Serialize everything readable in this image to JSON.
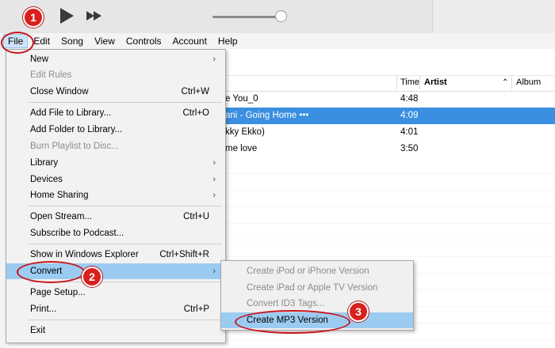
{
  "menubar": {
    "items": [
      {
        "label": "File"
      },
      {
        "label": "Edit"
      },
      {
        "label": "Song"
      },
      {
        "label": "View"
      },
      {
        "label": "Controls"
      },
      {
        "label": "Account"
      },
      {
        "label": "Help"
      }
    ]
  },
  "toolbar": {
    "icons": [
      "play-icon",
      "fast-forward-icon"
    ],
    "volume_level": 0.9
  },
  "table": {
    "headers": {
      "time": "Time",
      "artist": "Artist",
      "album": "Album"
    },
    "rows": [
      {
        "title": "e You_0",
        "time": "4:48",
        "selected": false
      },
      {
        "title": "ani - Going Home •••",
        "time": "4:09",
        "selected": true
      },
      {
        "title": "kky Ekko)",
        "time": "4:01",
        "selected": false
      },
      {
        "title": "me love",
        "time": "3:50",
        "selected": false
      }
    ]
  },
  "file_menu": {
    "items": [
      {
        "label": "New",
        "shortcut": "",
        "submenu": true,
        "disabled": false
      },
      {
        "label": "Edit Rules",
        "shortcut": "",
        "submenu": false,
        "disabled": true
      },
      {
        "label": "Close Window",
        "shortcut": "Ctrl+W",
        "submenu": false,
        "disabled": false
      },
      {
        "label": "Add File to Library...",
        "shortcut": "Ctrl+O",
        "submenu": false,
        "disabled": false
      },
      {
        "label": "Add Folder to Library...",
        "shortcut": "",
        "submenu": false,
        "disabled": false
      },
      {
        "label": "Burn Playlist to Disc...",
        "shortcut": "",
        "submenu": false,
        "disabled": true
      },
      {
        "label": "Library",
        "shortcut": "",
        "submenu": true,
        "disabled": false
      },
      {
        "label": "Devices",
        "shortcut": "",
        "submenu": true,
        "disabled": false
      },
      {
        "label": "Home Sharing",
        "shortcut": "",
        "submenu": true,
        "disabled": false
      },
      {
        "label": "Open Stream...",
        "shortcut": "Ctrl+U",
        "submenu": false,
        "disabled": false
      },
      {
        "label": "Subscribe to Podcast...",
        "shortcut": "",
        "submenu": false,
        "disabled": false
      },
      {
        "label": "Show in Windows Explorer",
        "shortcut": "Ctrl+Shift+R",
        "submenu": false,
        "disabled": false
      },
      {
        "label": "Convert",
        "shortcut": "",
        "submenu": true,
        "disabled": false
      },
      {
        "label": "Page Setup...",
        "shortcut": "",
        "submenu": false,
        "disabled": false
      },
      {
        "label": "Print...",
        "shortcut": "Ctrl+P",
        "submenu": false,
        "disabled": false
      },
      {
        "label": "Exit",
        "shortcut": "",
        "submenu": false,
        "disabled": false
      }
    ]
  },
  "convert_submenu": {
    "items": [
      {
        "label": "Create iPod or iPhone Version"
      },
      {
        "label": "Create iPad or Apple TV Version"
      },
      {
        "label": "Convert ID3 Tags..."
      },
      {
        "label": "Create MP3 Version"
      }
    ]
  },
  "annotations": {
    "step1": "1",
    "step2": "2",
    "step3": "3",
    "color": "#d8201e"
  },
  "colors": {
    "selection": "#3a8fe0",
    "menu_highlight": "#9ccbf1"
  }
}
